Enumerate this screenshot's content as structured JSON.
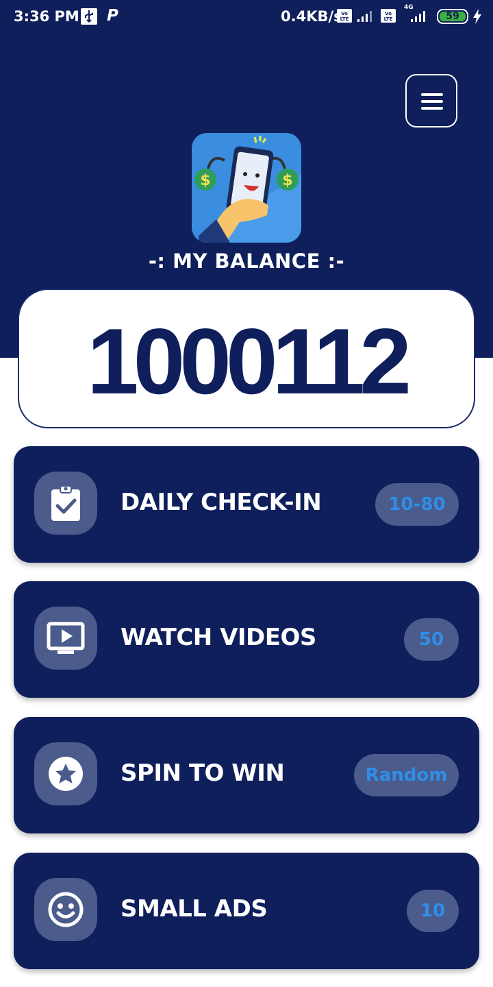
{
  "status_bar": {
    "time": "3:36 PM",
    "p_glyph": "P",
    "network_speed": "0.4KB/s",
    "volte_label": "Vo LTE",
    "net_type": "4G",
    "battery": "59"
  },
  "header": {
    "menu_icon": "hamburger-menu-icon",
    "balance_label": "-: MY BALANCE :-",
    "balance_value": "1000112"
  },
  "tasks": [
    {
      "label": "DAILY CHECK-IN",
      "badge": "10-80",
      "icon": "clipboard-check-icon"
    },
    {
      "label": "WATCH VIDEOS",
      "badge": "50",
      "icon": "tv-play-icon"
    },
    {
      "label": "SPIN TO WIN",
      "badge": "Random",
      "icon": "star-circle-icon"
    },
    {
      "label": "SMALL ADS",
      "badge": "10",
      "icon": "smiley-icon"
    }
  ],
  "colors": {
    "primary": "#0f1f5c",
    "icon_bg": "#4a5b8c",
    "badge_text": "#2f8fe8",
    "white": "#ffffff"
  }
}
